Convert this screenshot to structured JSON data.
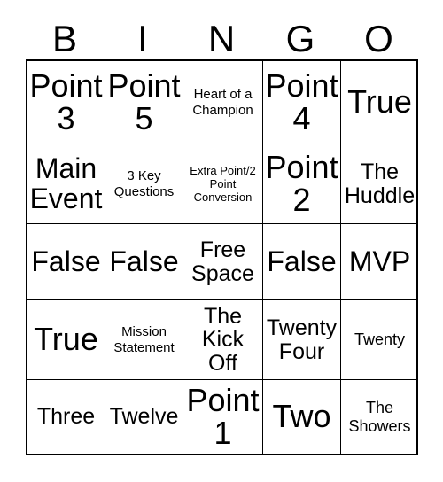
{
  "card": {
    "title": "BINGO",
    "headers": [
      "B",
      "I",
      "N",
      "G",
      "O"
    ],
    "free_space_label": "Free Space",
    "rows": [
      [
        {
          "text": "Point 3",
          "size": "xl"
        },
        {
          "text": "Point 5",
          "size": "xl"
        },
        {
          "text": "Heart of a Champion",
          "size": "xs"
        },
        {
          "text": "Point 4",
          "size": "xl"
        },
        {
          "text": "True",
          "size": "xl"
        }
      ],
      [
        {
          "text": "Main Event",
          "size": "lg"
        },
        {
          "text": "3 Key Questions",
          "size": "xs"
        },
        {
          "text": "Extra Point/2 Point Conversion",
          "size": "xxs"
        },
        {
          "text": "Point 2",
          "size": "xl"
        },
        {
          "text": "The Huddle",
          "size": "md"
        }
      ],
      [
        {
          "text": "False",
          "size": "lg"
        },
        {
          "text": "False",
          "size": "lg"
        },
        {
          "text": "Free Space",
          "size": "md"
        },
        {
          "text": "False",
          "size": "lg"
        },
        {
          "text": "MVP",
          "size": "lg"
        }
      ],
      [
        {
          "text": "True",
          "size": "xl"
        },
        {
          "text": "Mission Statement",
          "size": "xs"
        },
        {
          "text": "The Kick Off",
          "size": "md"
        },
        {
          "text": "Twenty Four",
          "size": "md"
        },
        {
          "text": "Twenty",
          "size": "sm"
        }
      ],
      [
        {
          "text": "Three",
          "size": "md"
        },
        {
          "text": "Twelve",
          "size": "md"
        },
        {
          "text": "Point 1",
          "size": "xl"
        },
        {
          "text": "Two",
          "size": "xl"
        },
        {
          "text": "The Showers",
          "size": "sm"
        }
      ]
    ]
  },
  "colors": {
    "background": "#ffffff",
    "text": "#000000",
    "grid_line": "#000000"
  }
}
